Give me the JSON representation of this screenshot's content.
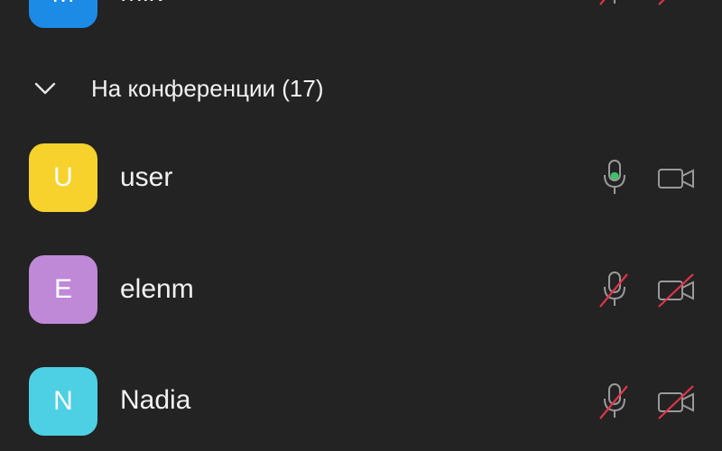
{
  "participants_above": [
    {
      "initial": "M",
      "name": "Mik",
      "avatar_color": "#1c8be6",
      "mic": "muted",
      "camera": "off"
    }
  ],
  "section": {
    "label": "На конференции (17)",
    "expanded": true,
    "icon": "chevron-down-icon"
  },
  "participants": [
    {
      "initial": "U",
      "name": "user",
      "avatar_color": "#f7d22c",
      "mic": "active",
      "camera": "on"
    },
    {
      "initial": "E",
      "name": "elenm",
      "avatar_color": "#c089d8",
      "mic": "muted",
      "camera": "off"
    },
    {
      "initial": "N",
      "name": "Nadia",
      "avatar_color": "#4ed0e4",
      "mic": "muted",
      "camera": "off"
    }
  ],
  "colors": {
    "background": "#232323",
    "icon": "#9a9a9a",
    "muted_slash": "#e0344a",
    "mic_active": "#3cc46a"
  }
}
